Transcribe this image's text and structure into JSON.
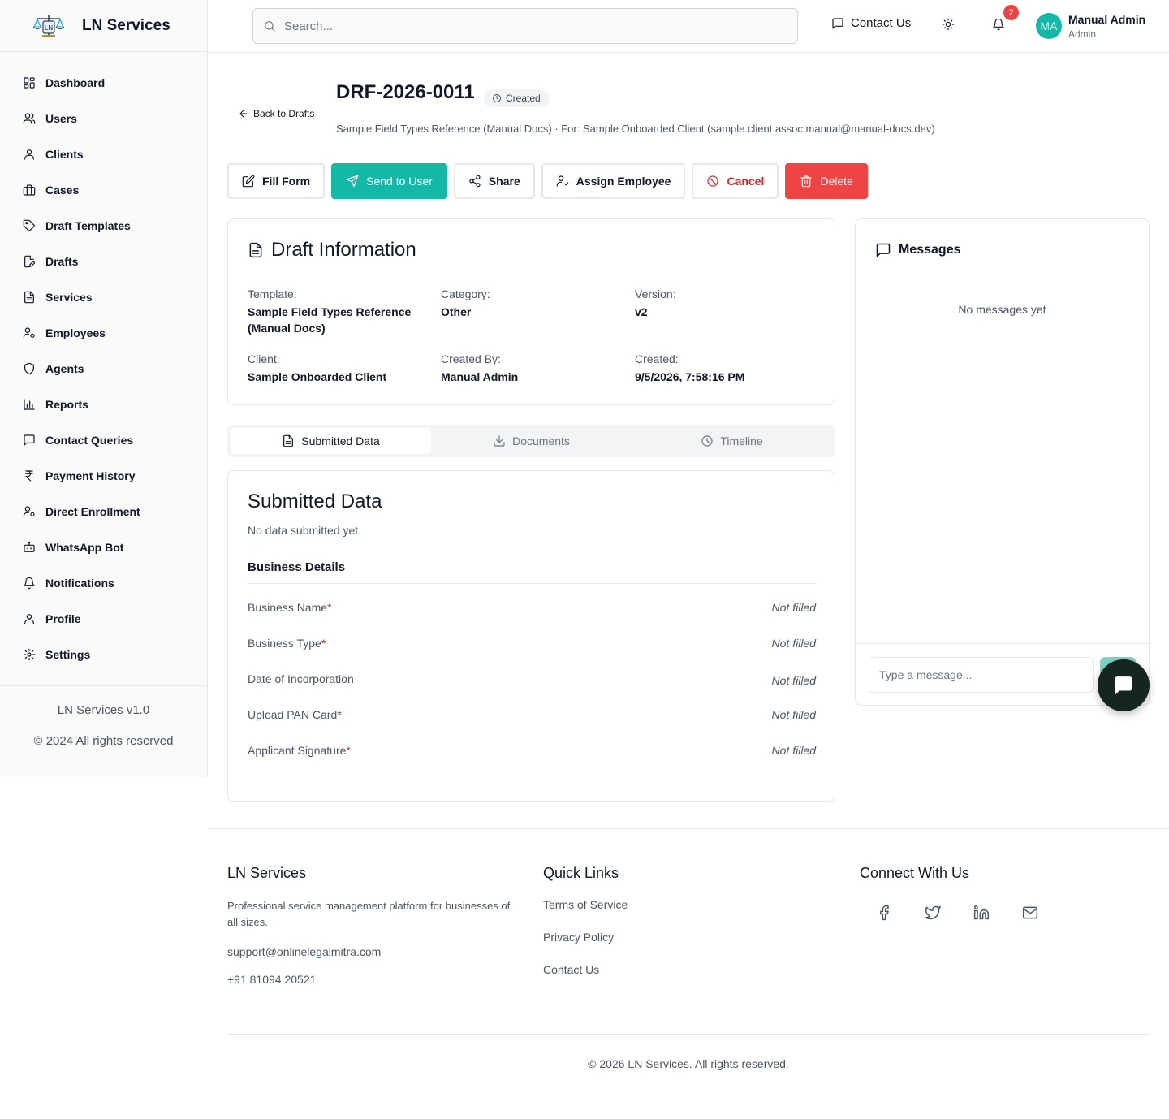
{
  "app": {
    "name": "LN Services",
    "version": "LN Services v1.0",
    "copyright": "© 2024 All rights reserved"
  },
  "sidebar": {
    "items": [
      {
        "label": "Dashboard",
        "icon": "grid-icon"
      },
      {
        "label": "Users",
        "icon": "users-icon"
      },
      {
        "label": "Clients",
        "icon": "user-icon"
      },
      {
        "label": "Cases",
        "icon": "briefcase-icon"
      },
      {
        "label": "Draft Templates",
        "icon": "tag-icon"
      },
      {
        "label": "Drafts",
        "icon": "file-edit-icon"
      },
      {
        "label": "Services",
        "icon": "file-text-icon"
      },
      {
        "label": "Employees",
        "icon": "user-cog-icon"
      },
      {
        "label": "Agents",
        "icon": "shield-icon"
      },
      {
        "label": "Reports",
        "icon": "bar-chart-icon"
      },
      {
        "label": "Contact Queries",
        "icon": "message-square-icon"
      },
      {
        "label": "Payment History",
        "icon": "rupee-icon"
      },
      {
        "label": "Direct Enrollment",
        "icon": "user-cog-icon"
      },
      {
        "label": "WhatsApp Bot",
        "icon": "bot-icon"
      },
      {
        "label": "Notifications",
        "icon": "bell-icon"
      },
      {
        "label": "Profile",
        "icon": "user-icon"
      },
      {
        "label": "Settings",
        "icon": "gear-icon"
      }
    ]
  },
  "header": {
    "search_placeholder": "Search...",
    "contact_label": "Contact Us",
    "notification_count": "2",
    "user": {
      "initials": "MA",
      "name": "Manual Admin",
      "role": "Admin"
    }
  },
  "page": {
    "back_label": "Back to Drafts",
    "draft_id": "DRF-2026-0011",
    "status": "Created",
    "subtitle": "Sample Field Types Reference (Manual Docs) · For: Sample Onboarded Client (sample.client.assoc.manual@manual-docs.dev)"
  },
  "actions": {
    "fill_form": "Fill Form",
    "send_to_user": "Send to User",
    "share": "Share",
    "assign_employee": "Assign Employee",
    "cancel": "Cancel",
    "delete": "Delete"
  },
  "info": {
    "title": "Draft Information",
    "fields": {
      "template": {
        "label": "Template:",
        "value": "Sample Field Types Reference (Manual Docs)"
      },
      "category": {
        "label": "Category:",
        "value": "Other"
      },
      "version": {
        "label": "Version:",
        "value": "v2"
      },
      "client": {
        "label": "Client:",
        "value": "Sample Onboarded Client"
      },
      "created_by": {
        "label": "Created By:",
        "value": "Manual Admin"
      },
      "created": {
        "label": "Created:",
        "value": "9/5/2026, 7:58:16 PM"
      }
    }
  },
  "tabs": {
    "submitted": "Submitted Data",
    "documents": "Documents",
    "timeline": "Timeline"
  },
  "submitted": {
    "title": "Submitted Data",
    "subtitle": "No data submitted yet",
    "section": "Business Details",
    "rows": [
      {
        "label": "Business Name",
        "required": "*",
        "value": "Not filled"
      },
      {
        "label": "Business Type",
        "required": "*",
        "value": "Not filled"
      },
      {
        "label": "Date of Incorporation",
        "required": "",
        "value": "Not filled"
      },
      {
        "label": "Upload PAN Card",
        "required": "*",
        "value": "Not filled"
      },
      {
        "label": "Applicant Signature",
        "required": "*",
        "value": "Not filled"
      }
    ]
  },
  "messages": {
    "title": "Messages",
    "empty": "No messages yet",
    "placeholder": "Type a message..."
  },
  "footer": {
    "brand": "LN Services",
    "description": "Professional service management platform for businesses of all sizes.",
    "email": "support@onlinelegalmitra.com",
    "phone": "+91 81094 20521",
    "quick_links_title": "Quick Links",
    "links": [
      "Terms of Service",
      "Privacy Policy",
      "Contact Us"
    ],
    "connect_title": "Connect With Us",
    "copyright": "© 2026 LN Services. All rights reserved."
  },
  "colors": {
    "accent": "#14b8a6",
    "danger": "#ef4444",
    "badge": "#ef4444"
  }
}
